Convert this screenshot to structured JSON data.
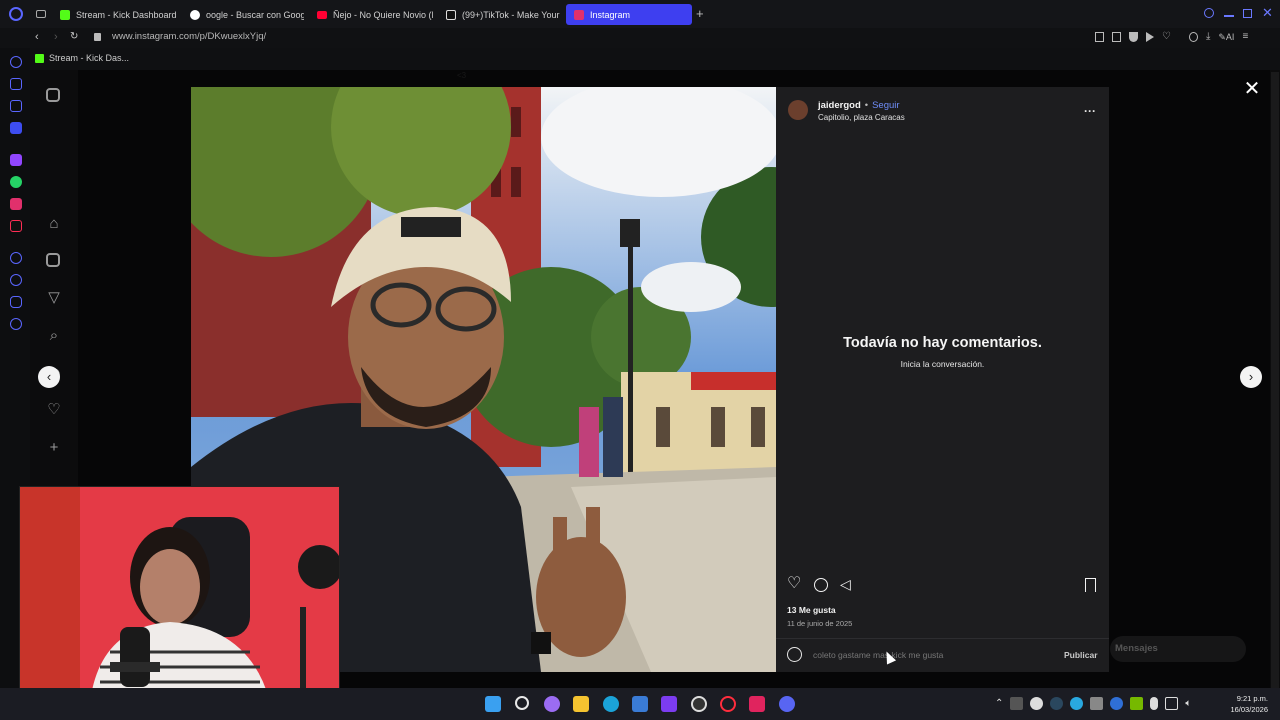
{
  "tabs": [
    {
      "label": "Stream - Kick Dashboard",
      "color": "#53fc18"
    },
    {
      "label": "oogle - Buscar con Google",
      "color": "#ffffff"
    },
    {
      "label": "Ñejo - No Quiere Novio (R",
      "color": "#ff0033"
    },
    {
      "label": "(99+)TikTok - Make Your D",
      "color": "#ffffff"
    },
    {
      "label": "Instagram",
      "color": "#e1306c"
    }
  ],
  "address": {
    "url": "www.instagram.com/p/DKwuexlxYjq/"
  },
  "bookmark": {
    "label": "Stream - Kick Das..."
  },
  "page": {
    "hint": "<3"
  },
  "post": {
    "username": "jaidergod",
    "separator": "•",
    "follow": "Seguir",
    "location": "Capitolio, plaza Caracas",
    "more": "···",
    "empty_title": "Todavía no hay comentarios.",
    "empty_subtitle": "Inicia la conversación.",
    "likes": "13 Me gusta",
    "date": "11 de junio de 2025",
    "comment_value": "coleto gastame mas kick me gusta",
    "publish": "Publicar"
  },
  "messages": {
    "label": "Mensajes"
  },
  "taskbar": {
    "time": "9:21 p.m.",
    "date": "16/03/2026"
  },
  "colors": {
    "accent_tab": "#3e3ff0",
    "follow": "#6e8cf7"
  }
}
